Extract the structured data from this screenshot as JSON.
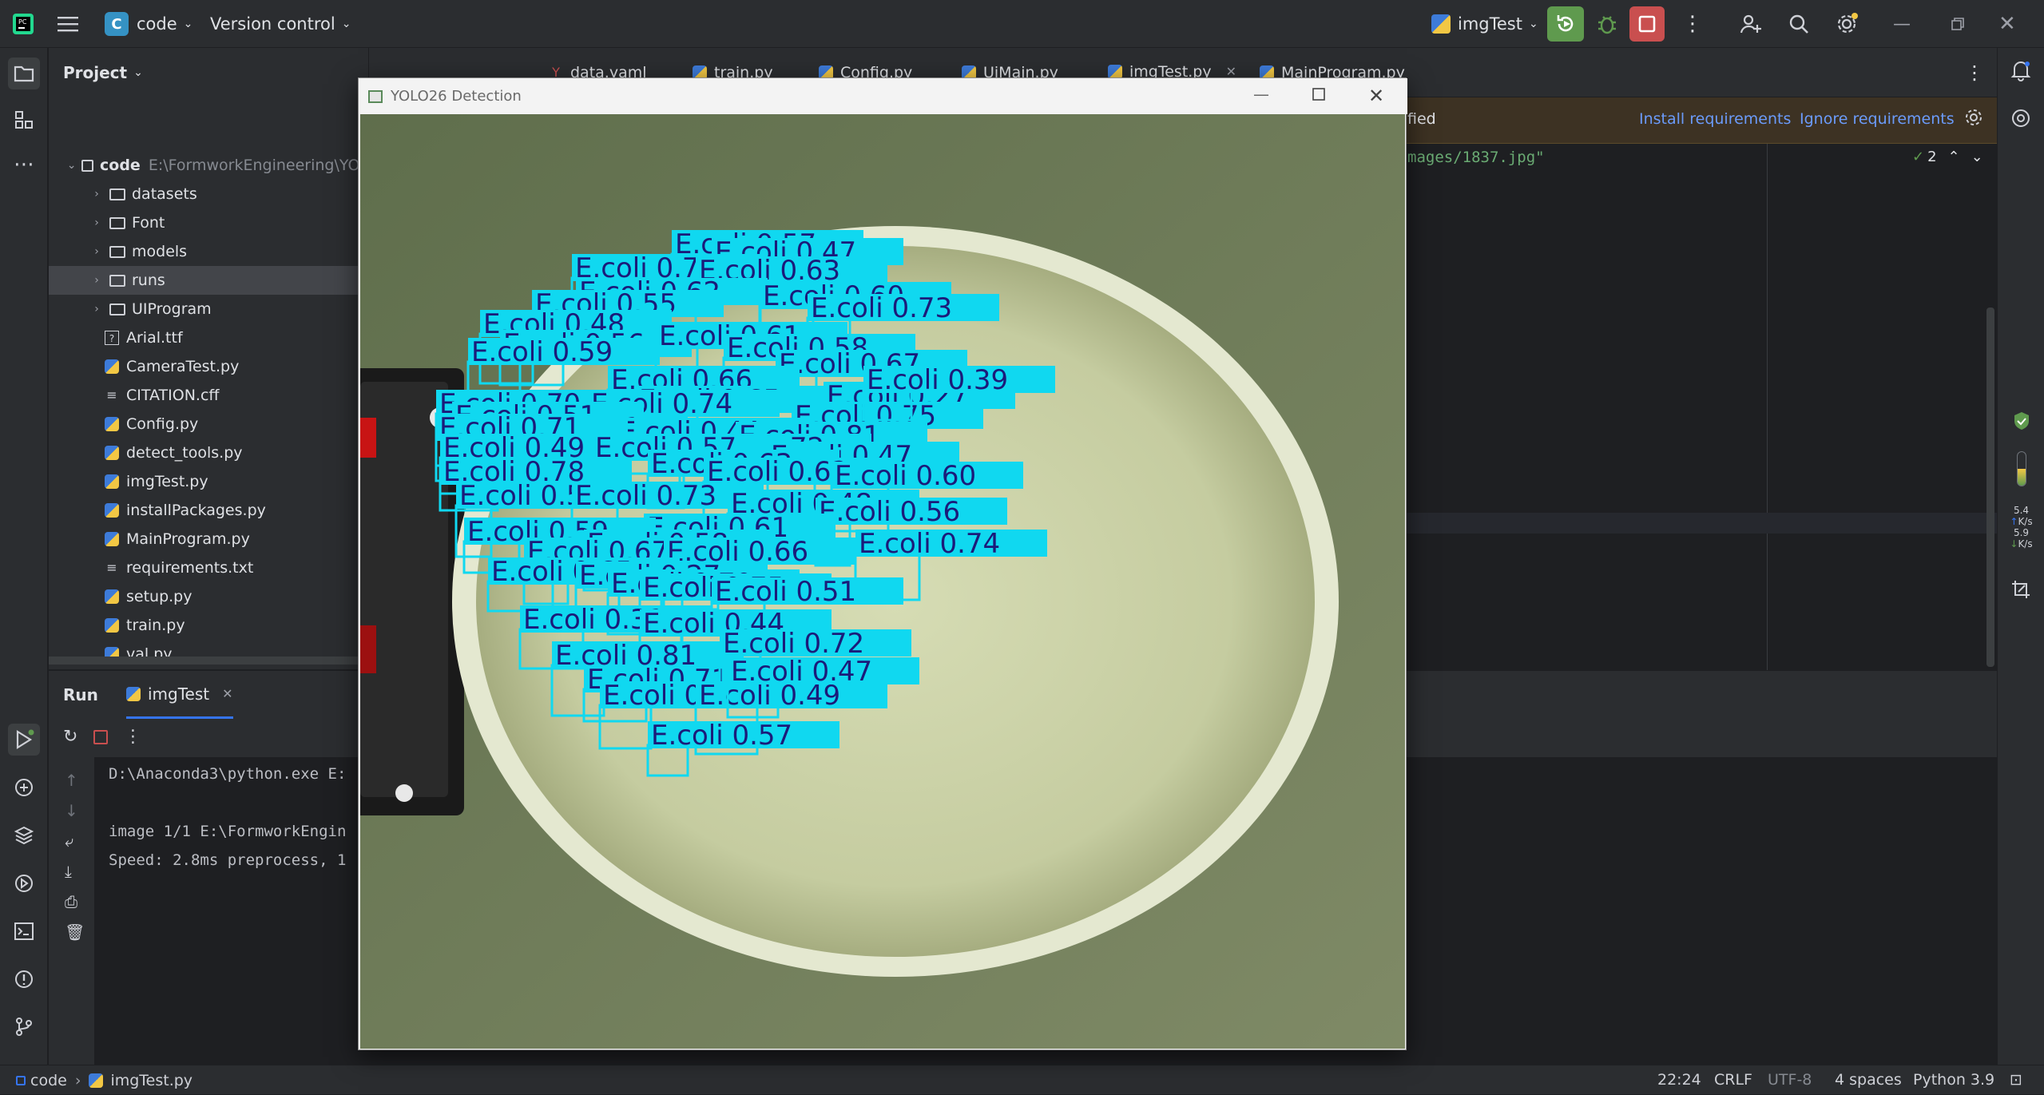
{
  "titlebar": {
    "project_badge": "C",
    "project_name": "code",
    "vcs_label": "Version control",
    "run_config": "imgTest"
  },
  "project_panel": {
    "title": "Project",
    "root_name": "code",
    "root_path": "E:\\FormworkEngineering\\YOL",
    "items": [
      {
        "label": "datasets",
        "kind": "folder"
      },
      {
        "label": "Font",
        "kind": "folder"
      },
      {
        "label": "models",
        "kind": "folder"
      },
      {
        "label": "runs",
        "kind": "folder"
      },
      {
        "label": "UIProgram",
        "kind": "folder"
      },
      {
        "label": "Arial.ttf",
        "kind": "unknown"
      },
      {
        "label": "CameraTest.py",
        "kind": "python"
      },
      {
        "label": "CITATION.cff",
        "kind": "text"
      },
      {
        "label": "Config.py",
        "kind": "python"
      },
      {
        "label": "detect_tools.py",
        "kind": "python"
      },
      {
        "label": "imgTest.py",
        "kind": "python"
      },
      {
        "label": "installPackages.py",
        "kind": "python"
      },
      {
        "label": "MainProgram.py",
        "kind": "python"
      },
      {
        "label": "requirements.txt",
        "kind": "text"
      },
      {
        "label": "setup.py",
        "kind": "python"
      },
      {
        "label": "train.py",
        "kind": "python"
      },
      {
        "label": "val.py",
        "kind": "python"
      },
      {
        "label": "VideoTest.py",
        "kind": "python"
      },
      {
        "label": "yolo26n.pt",
        "kind": "unknown"
      }
    ]
  },
  "editor": {
    "tabs": [
      {
        "label": "data.yaml"
      },
      {
        "label": "train.py"
      },
      {
        "label": "Config.py"
      },
      {
        "label": "UiMain.py"
      },
      {
        "label": "imgTest.py"
      },
      {
        "label": "MainProgram.py"
      }
    ],
    "banner_text": "fied",
    "install_label": "Install requirements",
    "ignore_label": "Ignore requirements",
    "code_fragment": "mages/1837.jpg\"",
    "inspection_count": "2"
  },
  "run_panel": {
    "title": "Run",
    "tab_label": "imgTest",
    "console_lines": [
      "D:\\Anaconda3\\python.exe E:",
      "",
      "image 1/1 E:\\FormworkEngin",
      "Speed: 2.8ms preprocess, 1"
    ]
  },
  "yolo_window": {
    "title": "YOLO26 Detection",
    "detection_class": "E.coli",
    "detections": [
      {
        "label": "E.coli 0.57"
      },
      {
        "label": "E.coli 0.47"
      },
      {
        "label": "E.coli 0.78"
      },
      {
        "label": "E.coli 0.63"
      },
      {
        "label": "E.coli 0.62"
      },
      {
        "label": "E.coli 0.60"
      },
      {
        "label": "E.coli 0.55"
      },
      {
        "label": "E.coli 0.73"
      },
      {
        "label": "E.coli 0.48"
      },
      {
        "label": "E.coli 0.56"
      },
      {
        "label": "E.coli 0.61"
      },
      {
        "label": "E.coli 0.59"
      },
      {
        "label": "E.coli 0.58"
      },
      {
        "label": "E.coli 0.67"
      },
      {
        "label": "E.coli 0.66"
      },
      {
        "label": "E.coli 0.65"
      },
      {
        "label": "E.coli 0.27"
      },
      {
        "label": "E.coli 0.70"
      },
      {
        "label": "E.coli 0.74"
      },
      {
        "label": "E.coli 0.75"
      },
      {
        "label": "E.coli 0.51"
      },
      {
        "label": "E.coli 0.31"
      },
      {
        "label": "E.coli 0.44"
      },
      {
        "label": "E.coli 0.81"
      },
      {
        "label": "E.coli 0.71"
      },
      {
        "label": "E.coli 0.72"
      },
      {
        "label": "E.coli 0.39"
      },
      {
        "label": "E.coli 0.49"
      }
    ]
  },
  "right_bar": {
    "net_up": "5.4",
    "net_up_unit": "K/s",
    "net_down": "5.9",
    "net_down_unit": "K/s"
  },
  "statusbar": {
    "crumb_project": "code",
    "crumb_file": "imgTest.py",
    "position": "22:24",
    "line_sep": "CRLF",
    "encoding": "UTF-8",
    "indent": "4 spaces",
    "interpreter": "Python 3.9"
  },
  "colors": {
    "bg_dark": "#1e1f22",
    "panel": "#2b2d30",
    "accent_green": "#5f9a4e",
    "accent_red": "#c94f4f",
    "detect_fill": "#10d8f0",
    "detect_text": "#1b1b7a"
  }
}
